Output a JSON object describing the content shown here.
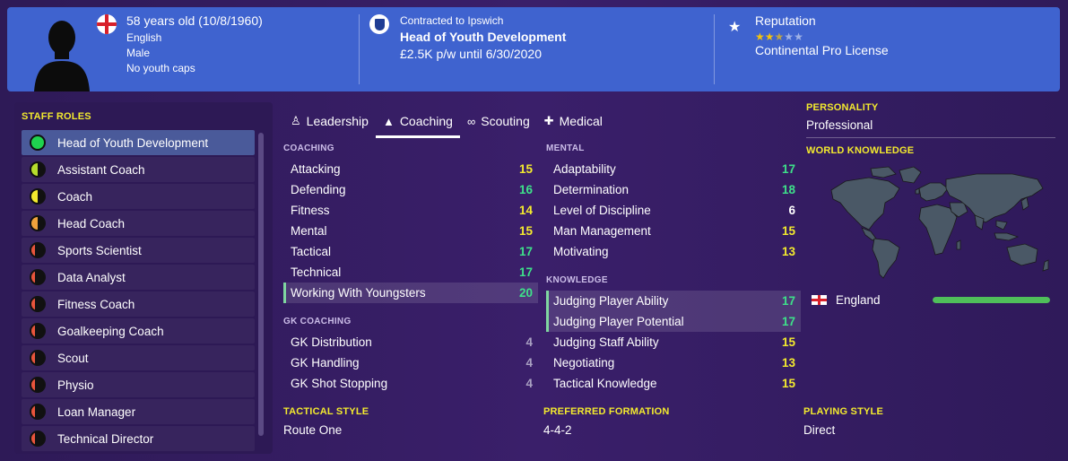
{
  "header": {
    "age_dob": "58 years old (10/8/1960)",
    "nationality": "English",
    "gender": "Male",
    "youth_caps": "No youth caps",
    "contract_line": "Contracted to Ipswich",
    "job_title": "Head of Youth Development",
    "wage_line": "£2.5K p/w until 6/30/2020",
    "reputation_label": "Reputation",
    "reputation_stars": 2.5,
    "reputation_max": 5,
    "license": "Continental Pro License",
    "flag_icon": "england-flag-icon",
    "club_icon": "ipswich-badge-icon"
  },
  "roles": {
    "title": "STAFF ROLES",
    "items": [
      {
        "label": "Head of Youth Development",
        "level": 1.0,
        "color": "#1fd34f",
        "selected": true
      },
      {
        "label": "Assistant Coach",
        "level": 0.5,
        "color": "#b6dd2c",
        "selected": false
      },
      {
        "label": "Coach",
        "level": 0.5,
        "color": "#f3ea2e",
        "selected": false
      },
      {
        "label": "Head Coach",
        "level": 0.5,
        "color": "#f0a23c",
        "selected": false
      },
      {
        "label": "Sports Scientist",
        "level": 0.3,
        "color": "#e8553c",
        "selected": false
      },
      {
        "label": "Data Analyst",
        "level": 0.3,
        "color": "#e8553c",
        "selected": false
      },
      {
        "label": "Fitness Coach",
        "level": 0.3,
        "color": "#e8553c",
        "selected": false
      },
      {
        "label": "Goalkeeping Coach",
        "level": 0.3,
        "color": "#e8553c",
        "selected": false
      },
      {
        "label": "Scout",
        "level": 0.3,
        "color": "#e8553c",
        "selected": false
      },
      {
        "label": "Physio",
        "level": 0.3,
        "color": "#e8553c",
        "selected": false
      },
      {
        "label": "Loan Manager",
        "level": 0.3,
        "color": "#e8553c",
        "selected": false
      },
      {
        "label": "Technical Director",
        "level": 0.3,
        "color": "#e8553c",
        "selected": false
      }
    ]
  },
  "tabs": [
    {
      "label": "Leadership",
      "icon": "leadership-icon",
      "active": false
    },
    {
      "label": "Coaching",
      "icon": "coaching-icon",
      "active": true
    },
    {
      "label": "Scouting",
      "icon": "binoculars-icon",
      "active": false
    },
    {
      "label": "Medical",
      "icon": "medical-kit-icon",
      "active": false
    }
  ],
  "coaching": {
    "title": "COACHING",
    "rows": [
      {
        "label": "Attacking",
        "value": "15",
        "tone": "yellow",
        "highlight": false
      },
      {
        "label": "Defending",
        "value": "16",
        "tone": "green",
        "highlight": false
      },
      {
        "label": "Fitness",
        "value": "14",
        "tone": "yellow",
        "highlight": false
      },
      {
        "label": "Mental",
        "value": "15",
        "tone": "yellow",
        "highlight": false
      },
      {
        "label": "Tactical",
        "value": "17",
        "tone": "green",
        "highlight": false
      },
      {
        "label": "Technical",
        "value": "17",
        "tone": "green",
        "highlight": false
      },
      {
        "label": "Working With Youngsters",
        "value": "20",
        "tone": "green",
        "highlight": true
      }
    ]
  },
  "gk_coaching": {
    "title": "GK COACHING",
    "rows": [
      {
        "label": "GK Distribution",
        "value": "4",
        "tone": "grey",
        "highlight": false
      },
      {
        "label": "GK Handling",
        "value": "4",
        "tone": "grey",
        "highlight": false
      },
      {
        "label": "GK Shot Stopping",
        "value": "4",
        "tone": "grey",
        "highlight": false
      }
    ]
  },
  "mental": {
    "title": "MENTAL",
    "rows": [
      {
        "label": "Adaptability",
        "value": "17",
        "tone": "green",
        "highlight": false
      },
      {
        "label": "Determination",
        "value": "18",
        "tone": "green",
        "highlight": false
      },
      {
        "label": "Level of Discipline",
        "value": "6",
        "tone": "white",
        "highlight": false
      },
      {
        "label": "Man Management",
        "value": "15",
        "tone": "yellow",
        "highlight": false
      },
      {
        "label": "Motivating",
        "value": "13",
        "tone": "yellow",
        "highlight": false
      }
    ]
  },
  "knowledge": {
    "title": "KNOWLEDGE",
    "rows": [
      {
        "label": "Judging Player Ability",
        "value": "17",
        "tone": "green",
        "highlight": true
      },
      {
        "label": "Judging Player Potential",
        "value": "17",
        "tone": "green",
        "highlight": true
      },
      {
        "label": "Judging Staff Ability",
        "value": "15",
        "tone": "yellow",
        "highlight": false
      },
      {
        "label": "Negotiating",
        "value": "13",
        "tone": "yellow",
        "highlight": false
      },
      {
        "label": "Tactical Knowledge",
        "value": "15",
        "tone": "yellow",
        "highlight": false
      }
    ]
  },
  "styles": {
    "tactical_title": "TACTICAL STYLE",
    "tactical_value": "Route One",
    "formation_title": "PREFERRED FORMATION",
    "formation_value": "4-4-2",
    "playing_title": "PLAYING STYLE",
    "playing_value": "Direct"
  },
  "right": {
    "personality_title": "PERSONALITY",
    "personality_value": "Professional",
    "world_title": "WORLD KNOWLEDGE",
    "nation": "England",
    "nation_knowledge": 1.0
  },
  "colors": {
    "accent_yellow": "#f3ea2e",
    "value_green": "#3ee08a",
    "header_blue": "#3f63cf"
  }
}
